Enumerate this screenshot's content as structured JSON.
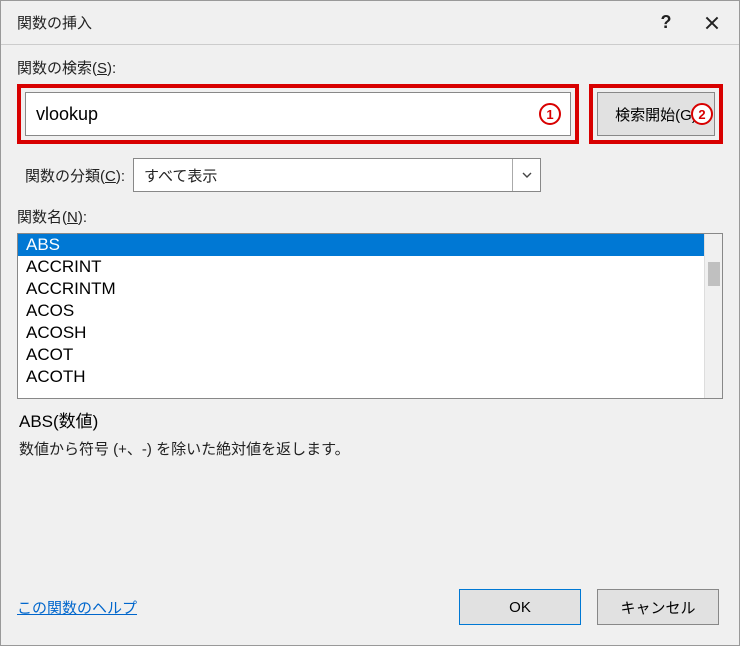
{
  "title": "関数の挿入",
  "labels": {
    "search_pre": "関数の検索(",
    "search_key": "S",
    "search_post": "):",
    "category_pre": "関数の分類(",
    "category_key": "C",
    "category_post": "):",
    "name_pre": "関数名(",
    "name_key": "N",
    "name_post": "):"
  },
  "search": {
    "value": "vlookup"
  },
  "go_button": "検索開始(G)",
  "category": {
    "value": "すべて表示"
  },
  "functions": [
    "ABS",
    "ACCRINT",
    "ACCRINTM",
    "ACOS",
    "ACOSH",
    "ACOT",
    "ACOTH"
  ],
  "selected_index": 0,
  "description": {
    "signature": "ABS(数値)",
    "text": "数値から符号 (+、-) を除いた絶対値を返します。"
  },
  "help_link": "この関数のヘルプ",
  "buttons": {
    "ok": "OK",
    "cancel": "キャンセル"
  },
  "callouts": {
    "one": "1",
    "two": "2"
  }
}
